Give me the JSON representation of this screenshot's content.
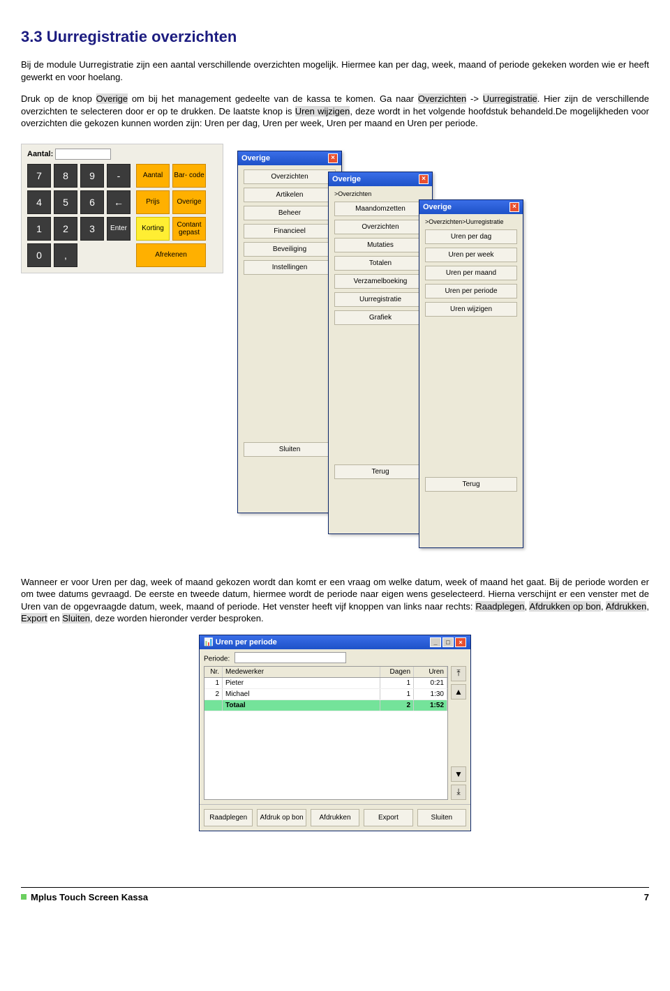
{
  "heading": "3.3 Uurregistratie overzichten",
  "para1": "Bij de module Uurregistratie zijn een aantal verschillende overzichten mogelijk. Hiermee kan per dag, week, maand of periode gekeken worden wie er heeft gewerkt en voor hoelang.",
  "para2a": "Druk op de knop ",
  "hl_overige": "Overige",
  "para2b": " om bij het management gedeelte van de kassa te komen. Ga naar ",
  "hl_overzichten": "Overzichten",
  "para2c": " -> ",
  "hl_uur": "Uurregistratie",
  "para2d": ". Hier zijn de verschillende overzichten te selecteren door er op te drukken. De laatste knop is ",
  "hl_urenw": "Uren wijzigen",
  "para2e": ", deze wordt in het volgende hoofdstuk behandeld.De mogelijkheden voor overzichten die gekozen kunnen worden zijn: Uren per dag, Uren per week, Uren per maand en Uren per periode.",
  "keypad": {
    "aantal_label": "Aantal:",
    "nums": [
      "7",
      "8",
      "9",
      "-",
      "4",
      "5",
      "6",
      "←",
      "1",
      "2",
      "3",
      "Enter",
      "0",
      ",",
      "",
      ""
    ],
    "side": {
      "aantal": "Aantal",
      "barcode": "Bar-\ncode",
      "prijs": "Prijs",
      "overige": "Overige",
      "korting": "Korting",
      "contant": "Contant\ngepast",
      "afrekenen": "Afrekenen"
    }
  },
  "win1": {
    "title": "Overige",
    "items": [
      "Overzichten",
      "Artikelen",
      "Beheer",
      "Financieel",
      "Beveiliging",
      "Instellingen"
    ],
    "close": "Sluiten"
  },
  "win2": {
    "title": "Overige",
    "crumb": ">Overzichten",
    "items": [
      "Maandomzetten",
      "Overzichten",
      "Mutaties",
      "Totalen",
      "Verzamelboeking",
      "Uurregistratie",
      "Grafiek"
    ],
    "close": "Terug"
  },
  "win3": {
    "title": "Overige",
    "crumb": ">Overzichten>Uurregistratie",
    "items": [
      "Uren per dag",
      "Uren per week",
      "Uren per maand",
      "Uren per periode",
      "Uren wijzigen"
    ],
    "close": "Terug"
  },
  "para3a": "Wanneer er voor Uren per dag, week of maand gekozen wordt dan komt er een vraag om welke datum, week of maand het gaat. Bij de periode worden er om twee datums gevraagd. De eerste en tweede datum, hiermee wordt de periode naar eigen wens geselecteerd. Hierna verschijnt er een venster met de Uren van de opgevraagde datum, week, maand of periode. Het venster heeft vijf knoppen van links naar rechts: ",
  "hl_r": "Raadplegen",
  "c1": ", ",
  "hl_a1": "Afdrukken op bon",
  "c2": ", ",
  "hl_a2": "Afdrukken",
  "c3": ", ",
  "hl_e": "Export",
  "c4": " en ",
  "hl_s": "Sluiten",
  "para3b": ", deze worden hieronder verder besproken.",
  "periode": {
    "title": "Uren per periode",
    "label": "Periode:",
    "headers": {
      "nr": "Nr.",
      "med": "Medewerker",
      "dagen": "Dagen",
      "uren": "Uren"
    },
    "rows": [
      {
        "nr": "1",
        "med": "Pieter",
        "dagen": "1",
        "uren": "0:21"
      },
      {
        "nr": "2",
        "med": "Michael",
        "dagen": "1",
        "uren": "1:30"
      }
    ],
    "total": {
      "nr": "",
      "med": "Totaal",
      "dagen": "2",
      "uren": "1:52"
    },
    "buttons": [
      "Raadplegen",
      "Afdruk op bon",
      "Afdrukken",
      "Export",
      "Sluiten"
    ]
  },
  "footer": {
    "name": "Mplus Touch Screen Kassa",
    "page": "7"
  }
}
